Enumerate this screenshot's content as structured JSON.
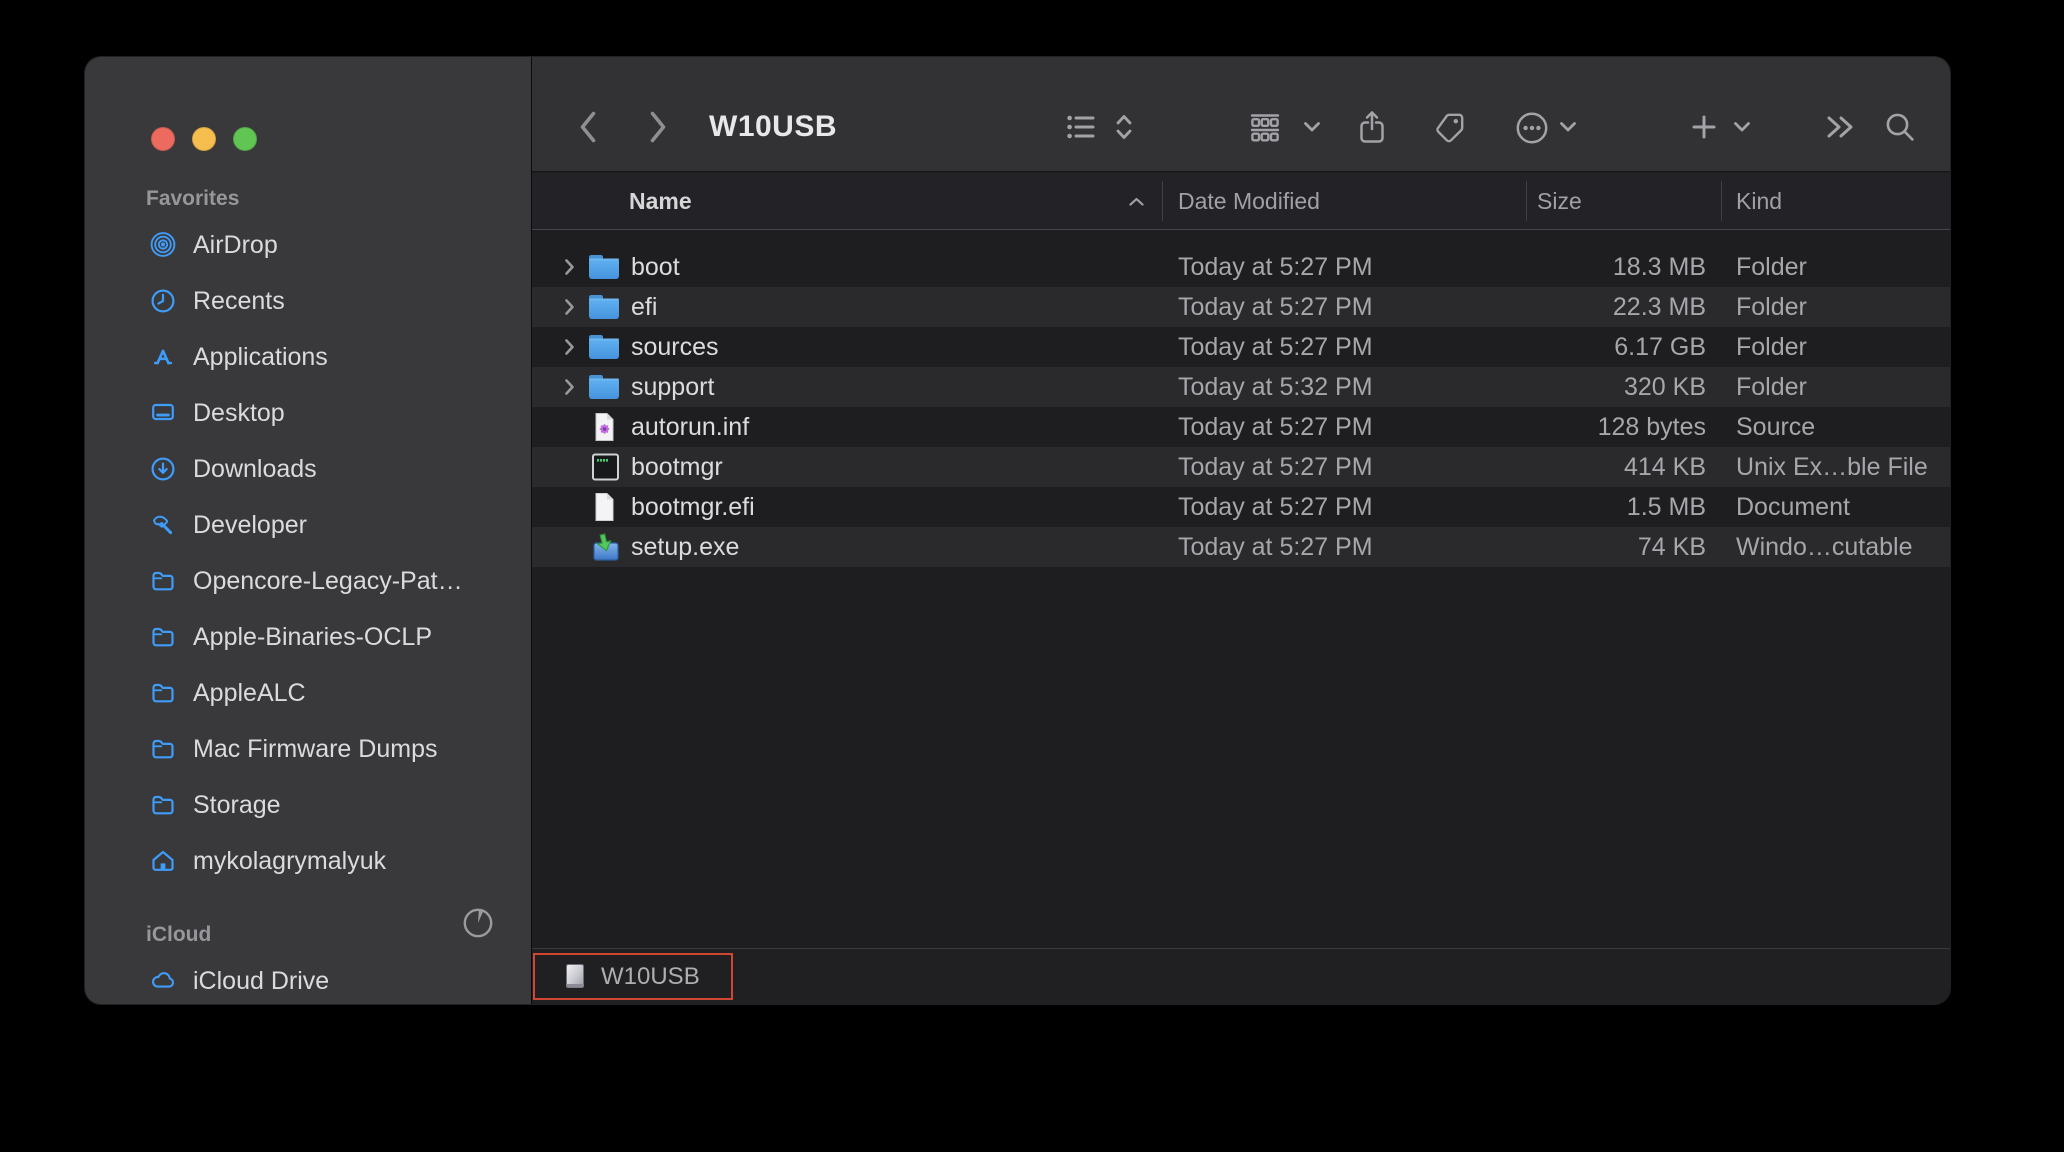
{
  "window": {
    "title": "W10USB"
  },
  "toolbar": {
    "title": "W10USB",
    "icons": [
      "back",
      "forward",
      "view-list",
      "sort-chevrons",
      "group-by",
      "share",
      "tags",
      "more-actions",
      "add",
      "overflow",
      "search"
    ]
  },
  "sidebar": {
    "sections": [
      {
        "label": "Favorites",
        "items": [
          {
            "label": "AirDrop",
            "icon": "airdrop"
          },
          {
            "label": "Recents",
            "icon": "clock"
          },
          {
            "label": "Applications",
            "icon": "app-store"
          },
          {
            "label": "Desktop",
            "icon": "desktop"
          },
          {
            "label": "Downloads",
            "icon": "download-circle"
          },
          {
            "label": "Developer",
            "icon": "hammer"
          },
          {
            "label": "Opencore-Legacy-Pat…",
            "icon": "folder"
          },
          {
            "label": "Apple-Binaries-OCLP",
            "icon": "folder"
          },
          {
            "label": "AppleALC",
            "icon": "folder"
          },
          {
            "label": "Mac Firmware Dumps",
            "icon": "folder"
          },
          {
            "label": "Storage",
            "icon": "folder"
          },
          {
            "label": "mykolagrymalyuk",
            "icon": "home"
          }
        ]
      },
      {
        "label": "iCloud",
        "items": [
          {
            "label": "iCloud Drive",
            "icon": "cloud",
            "trailing_icon": "pie-progress"
          }
        ]
      }
    ]
  },
  "list": {
    "columns": [
      {
        "label": "Name",
        "sorted": "ascending"
      },
      {
        "label": "Date Modified"
      },
      {
        "label": "Size"
      },
      {
        "label": "Kind"
      }
    ],
    "rows": [
      {
        "name": "boot",
        "icon": "folder",
        "expandable": true,
        "date_modified": "Today at 5:27 PM",
        "size": "18.3 MB",
        "kind": "Folder"
      },
      {
        "name": "efi",
        "icon": "folder",
        "expandable": true,
        "date_modified": "Today at 5:27 PM",
        "size": "22.3 MB",
        "kind": "Folder"
      },
      {
        "name": "sources",
        "icon": "folder",
        "expandable": true,
        "date_modified": "Today at 5:27 PM",
        "size": "6.17 GB",
        "kind": "Folder"
      },
      {
        "name": "support",
        "icon": "folder",
        "expandable": true,
        "date_modified": "Today at 5:32 PM",
        "size": "320 KB",
        "kind": "Folder"
      },
      {
        "name": "autorun.inf",
        "icon": "setup-info-file",
        "expandable": false,
        "date_modified": "Today at 5:27 PM",
        "size": "128 bytes",
        "kind": "Source"
      },
      {
        "name": "bootmgr",
        "icon": "unix-executable",
        "expandable": false,
        "date_modified": "Today at 5:27 PM",
        "size": "414 KB",
        "kind": "Unix Ex…ble File"
      },
      {
        "name": "bootmgr.efi",
        "icon": "document",
        "expandable": false,
        "date_modified": "Today at 5:27 PM",
        "size": "1.5 MB",
        "kind": "Document"
      },
      {
        "name": "setup.exe",
        "icon": "windows-installer",
        "expandable": false,
        "date_modified": "Today at 5:27 PM",
        "size": "74 KB",
        "kind": "Windo…cutable"
      }
    ]
  },
  "footer": {
    "volume": "W10USB"
  },
  "colors": {
    "accent_blue": "#3f9cf8",
    "sidebar_bg": "#39393b",
    "toolbar_bg": "#323235",
    "row_alt_bg": "#2a2a2d",
    "traffic_red": "#ed6a5f",
    "traffic_yellow": "#f6be4f",
    "traffic_green": "#61c554",
    "annotation_red": "#cf4631"
  }
}
